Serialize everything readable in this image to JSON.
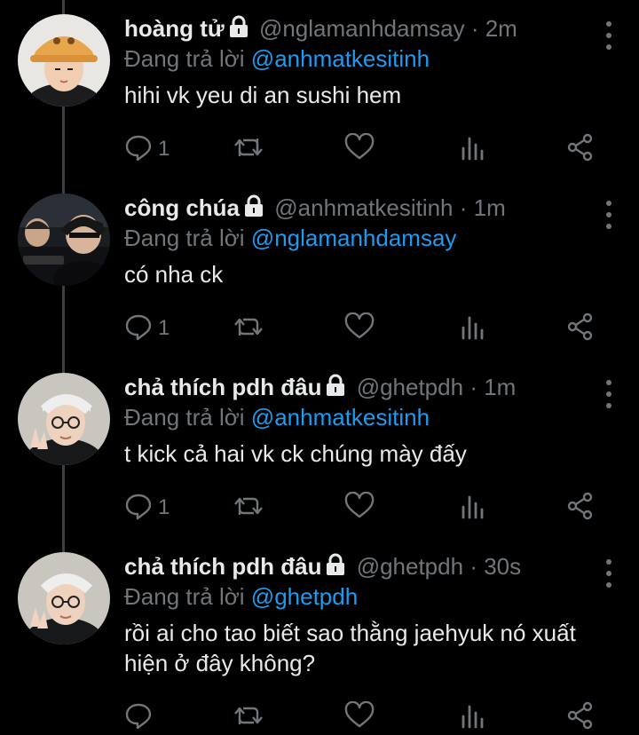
{
  "reply_prefix": "Đang trả lời",
  "tweets": [
    {
      "name": "hoàng tử",
      "handle": "@nglamanhdamsay",
      "separator": "·",
      "time": "2m",
      "reply_to": "@anhmatkesitinh",
      "text": "hihi vk yeu di an sushi hem",
      "reply_count": "1"
    },
    {
      "name": "công chúa",
      "handle": "@anhmatkesitinh",
      "separator": "·",
      "time": "1m",
      "reply_to": "@nglamanhdamsay",
      "text": "có nha ck",
      "reply_count": "1"
    },
    {
      "name": "chả thích pdh đâu",
      "handle": "@ghetpdh",
      "separator": "·",
      "time": "1m",
      "reply_to": "@anhmatkesitinh",
      "text": "t kick cả hai vk ck chúng mày đấy",
      "reply_count": "1"
    },
    {
      "name": "chả thích pdh đâu",
      "handle": "@ghetpdh",
      "separator": "·",
      "time": "30s",
      "reply_to": "@ghetpdh",
      "text": "rồi ai cho tao biết sao thằng jaehyuk nó xuất hiện ở đây không?",
      "reply_count": ""
    }
  ],
  "colors": {
    "background": "#000000",
    "text": "#e7e9ea",
    "muted": "#71767b",
    "link": "#1d9bf0",
    "thread_line": "#3e4144"
  }
}
